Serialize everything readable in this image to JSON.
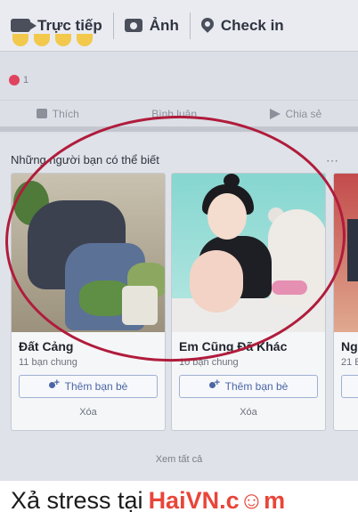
{
  "composer": {
    "live_label": "Trực tiếp",
    "photo_label": "Ảnh",
    "checkin_label": "Check in"
  },
  "post": {
    "like_count": "1",
    "like_label": "Thích",
    "comment_label": "Bình luận",
    "share_label": "Chia sẻ"
  },
  "pymk": {
    "title": "Những người bạn có thể biết",
    "cards": [
      {
        "name": "Đất Cảng",
        "mutual": "11 bạn chung",
        "add_label": "Thêm bạn bè",
        "remove_label": "Xóa"
      },
      {
        "name": "Em Cũng Đã Khác",
        "mutual": "10 bạn chung",
        "add_label": "Thêm bạn bè",
        "remove_label": "Xóa"
      },
      {
        "name": "Ng",
        "mutual": "21 B",
        "add_label": "",
        "remove_label": ""
      }
    ],
    "see_all": "Xem tất cả"
  },
  "footer": {
    "text_prefix": "Xả stress tại",
    "brand": "HaiVN.c☺m"
  },
  "colors": {
    "circle": "#b01c3c",
    "brand": "#e8463a",
    "button_text": "#4b66a6"
  }
}
